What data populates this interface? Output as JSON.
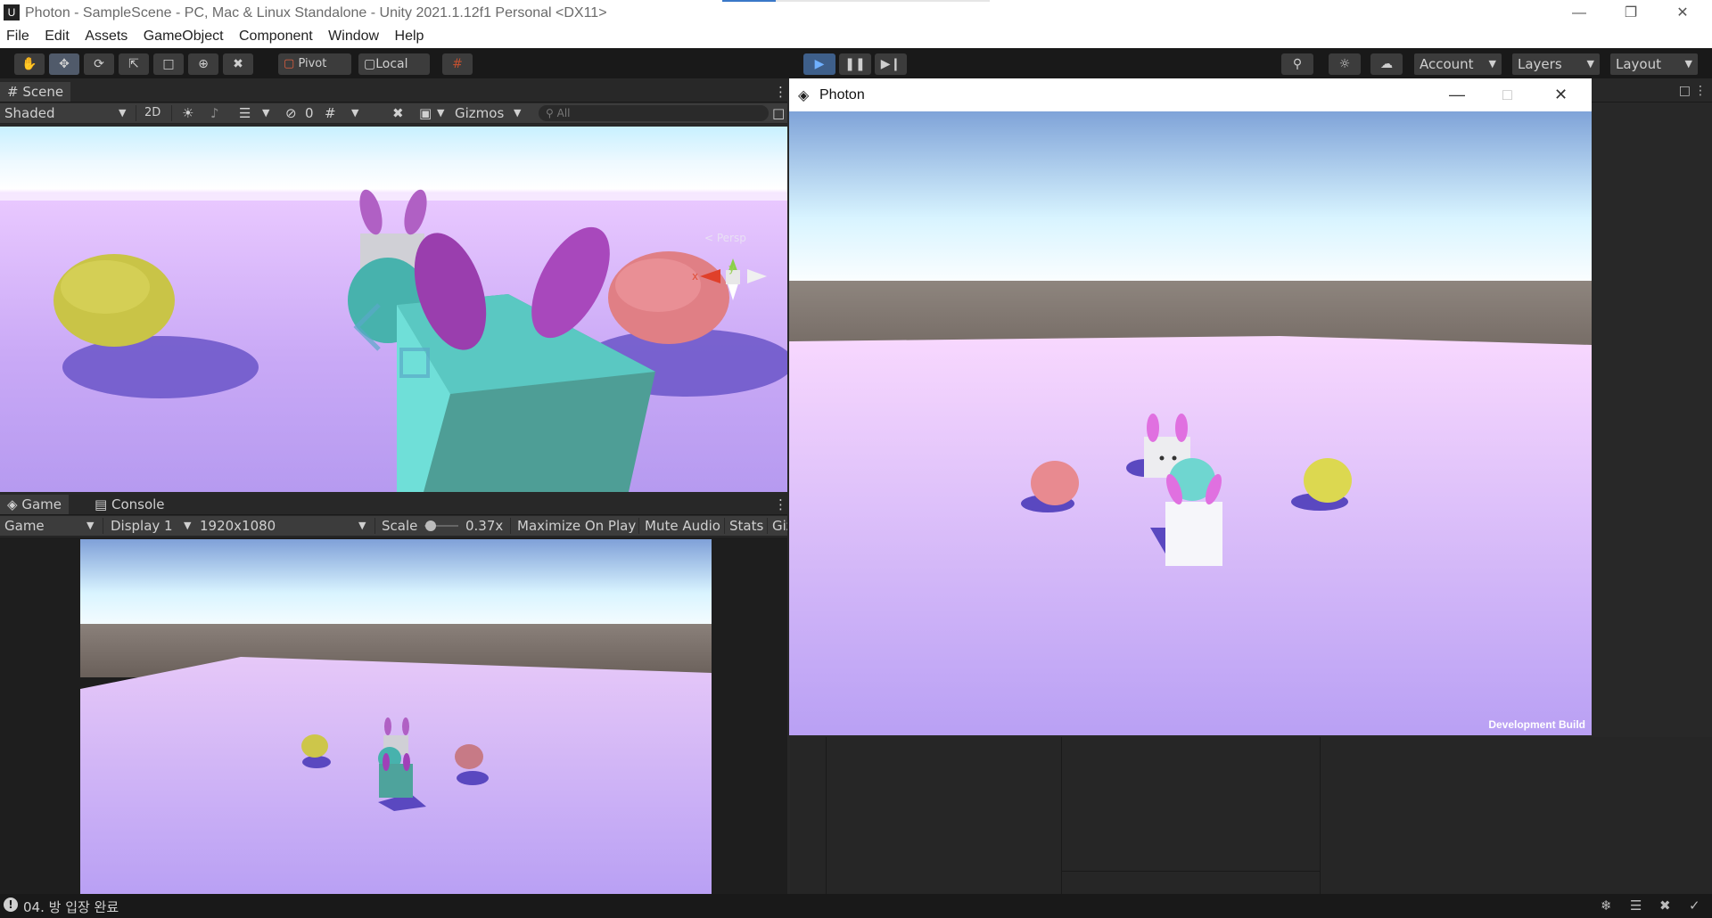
{
  "window": {
    "title": "Photon - SampleScene - PC, Mac & Linux Standalone - Unity 2021.1.12f1 Personal <DX11>",
    "logo": "U"
  },
  "menu": [
    "File",
    "Edit",
    "Assets",
    "GameObject",
    "Component",
    "Window",
    "Help"
  ],
  "toolbar": {
    "pivot_label": "Pivot",
    "local_label": "Local",
    "account_label": "Account",
    "layers_label": "Layers",
    "layout_label": "Layout"
  },
  "scene": {
    "tab_label": "Scene",
    "shading_mode": "Shaded",
    "toggle_2d": "2D",
    "hidden_count": "0",
    "gizmos_label": "Gizmos",
    "search_placeholder": "All",
    "axis_y": "y",
    "axis_x": "x",
    "persp_label": "< Persp"
  },
  "game": {
    "tab_game": "Game",
    "tab_console": "Console",
    "view_mode": "Game",
    "display": "Display 1",
    "resolution": "1920x1080",
    "scale_label": "Scale",
    "scale_value": "0.37x",
    "scale_fraction": 0.05,
    "maximize_label": "Maximize On Play",
    "mute_label": "Mute Audio",
    "stats_label": "Stats",
    "gizmos_cut": "Giz"
  },
  "photon_window": {
    "title": "Photon",
    "dev_build": "Development Build"
  },
  "status": {
    "message": "04. 방 입장 완료"
  },
  "colors": {
    "play_accent": "#3e5f8a",
    "sky_top": "#7fa3d8",
    "floor": "#c7a8f7",
    "cube_cyan": "#6fd6d0",
    "ear_pink": "#d066d8",
    "ball_yellow": "#d8d650",
    "ball_pink": "#e88a90"
  },
  "icons": [
    "hand-icon",
    "move-icon",
    "rotate-icon",
    "scale-icon",
    "rect-icon",
    "transform-icon",
    "custom-tool-icon",
    "search-icon",
    "cloud-icon",
    "play-icon",
    "pause-icon",
    "step-icon",
    "lock-icon"
  ]
}
